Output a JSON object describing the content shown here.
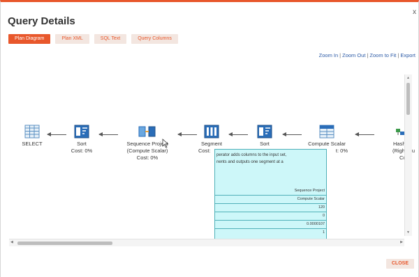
{
  "dialog": {
    "title": "Query Details",
    "close_glyph": "x"
  },
  "tabs": [
    {
      "label": "Plan Diagram",
      "active": true
    },
    {
      "label": "Plan XML",
      "active": false
    },
    {
      "label": "SQL Text",
      "active": false
    },
    {
      "label": "Query Columns",
      "active": false
    }
  ],
  "zoom": {
    "zoom_in": "Zoom In",
    "zoom_out": "Zoom Out",
    "zoom_fit": "Zoom to Fit",
    "export": "Export",
    "separator": "|"
  },
  "plan": {
    "nodes": [
      {
        "icon": "table-icon",
        "name": "SELECT",
        "name2": "",
        "cost": ""
      },
      {
        "icon": "sort-icon",
        "name": "Sort",
        "name2": "",
        "cost": "Cost: 0%"
      },
      {
        "icon": "sequence-project-icon",
        "name": "Sequence Project",
        "name2": "(Compute Scalar)",
        "cost": "Cost: 0%"
      },
      {
        "icon": "segment-icon",
        "name": "Segment",
        "name2": "",
        "cost": "Cost:"
      },
      {
        "icon": "sort-icon",
        "name": "Sort",
        "name2": "",
        "cost": ""
      },
      {
        "icon": "compute-scalar-icon",
        "name": "Compute Scalar",
        "name2": "",
        "cost": "t: 0%"
      },
      {
        "icon": "hash-match-icon",
        "name": "Hash M",
        "name2": "(Right Ou",
        "cost": "Cost"
      }
    ]
  },
  "tooltip": {
    "desc1": "perator adds columns to the input set,",
    "desc2": "nents and outputs one segment at a",
    "rows": [
      "Sequence Project",
      "Compute Scalar",
      "120",
      "0",
      "0.0000107",
      "1"
    ]
  },
  "buttons": {
    "close": "CLOSE"
  },
  "colors": {
    "accent": "#e8572b",
    "tab_bg": "#f3e6e0",
    "link": "#2b5aa6",
    "tooltip_bg": "#cdf7f9",
    "icon_blue": "#2a6db8"
  }
}
